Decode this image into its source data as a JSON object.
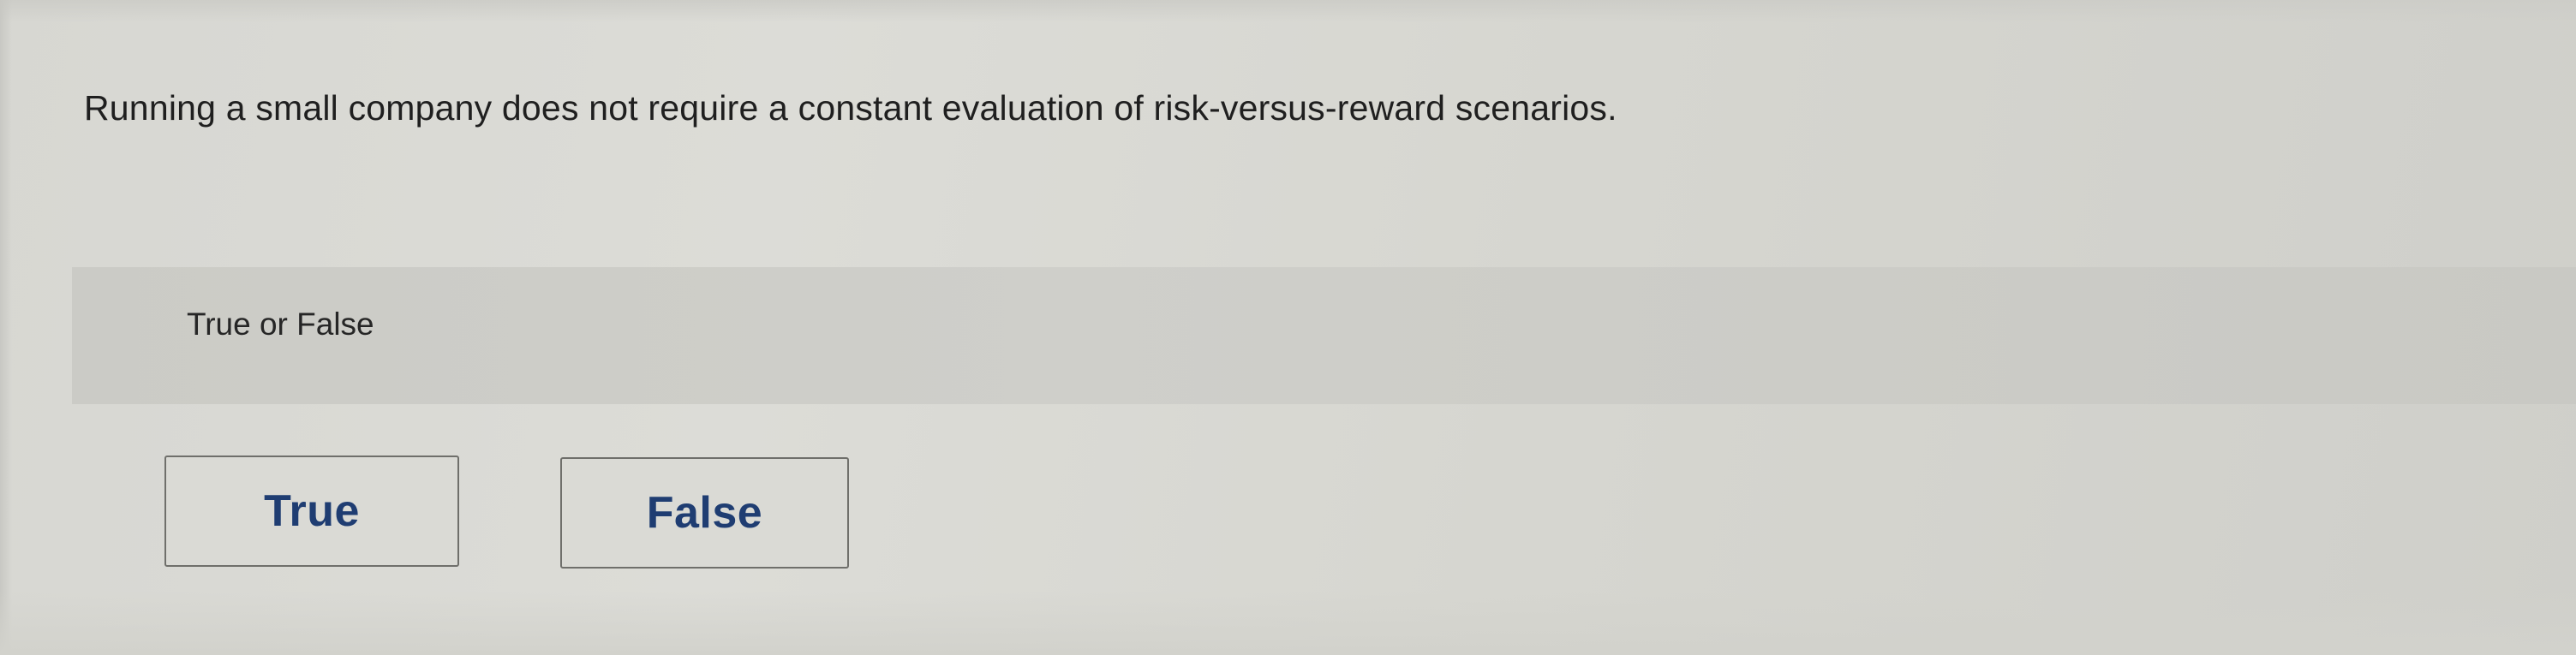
{
  "question": {
    "text": "Running a small company does not require a constant evaluation of risk-versus-reward scenarios."
  },
  "prompt": {
    "label": "True or False"
  },
  "choices": [
    {
      "label": "True"
    },
    {
      "label": "False"
    }
  ],
  "colors": {
    "page_background": "#d8d8d3",
    "prompt_band": "#cdcdc8",
    "choice_text": "#1f3d72",
    "choice_border": "#6f6f6b"
  }
}
